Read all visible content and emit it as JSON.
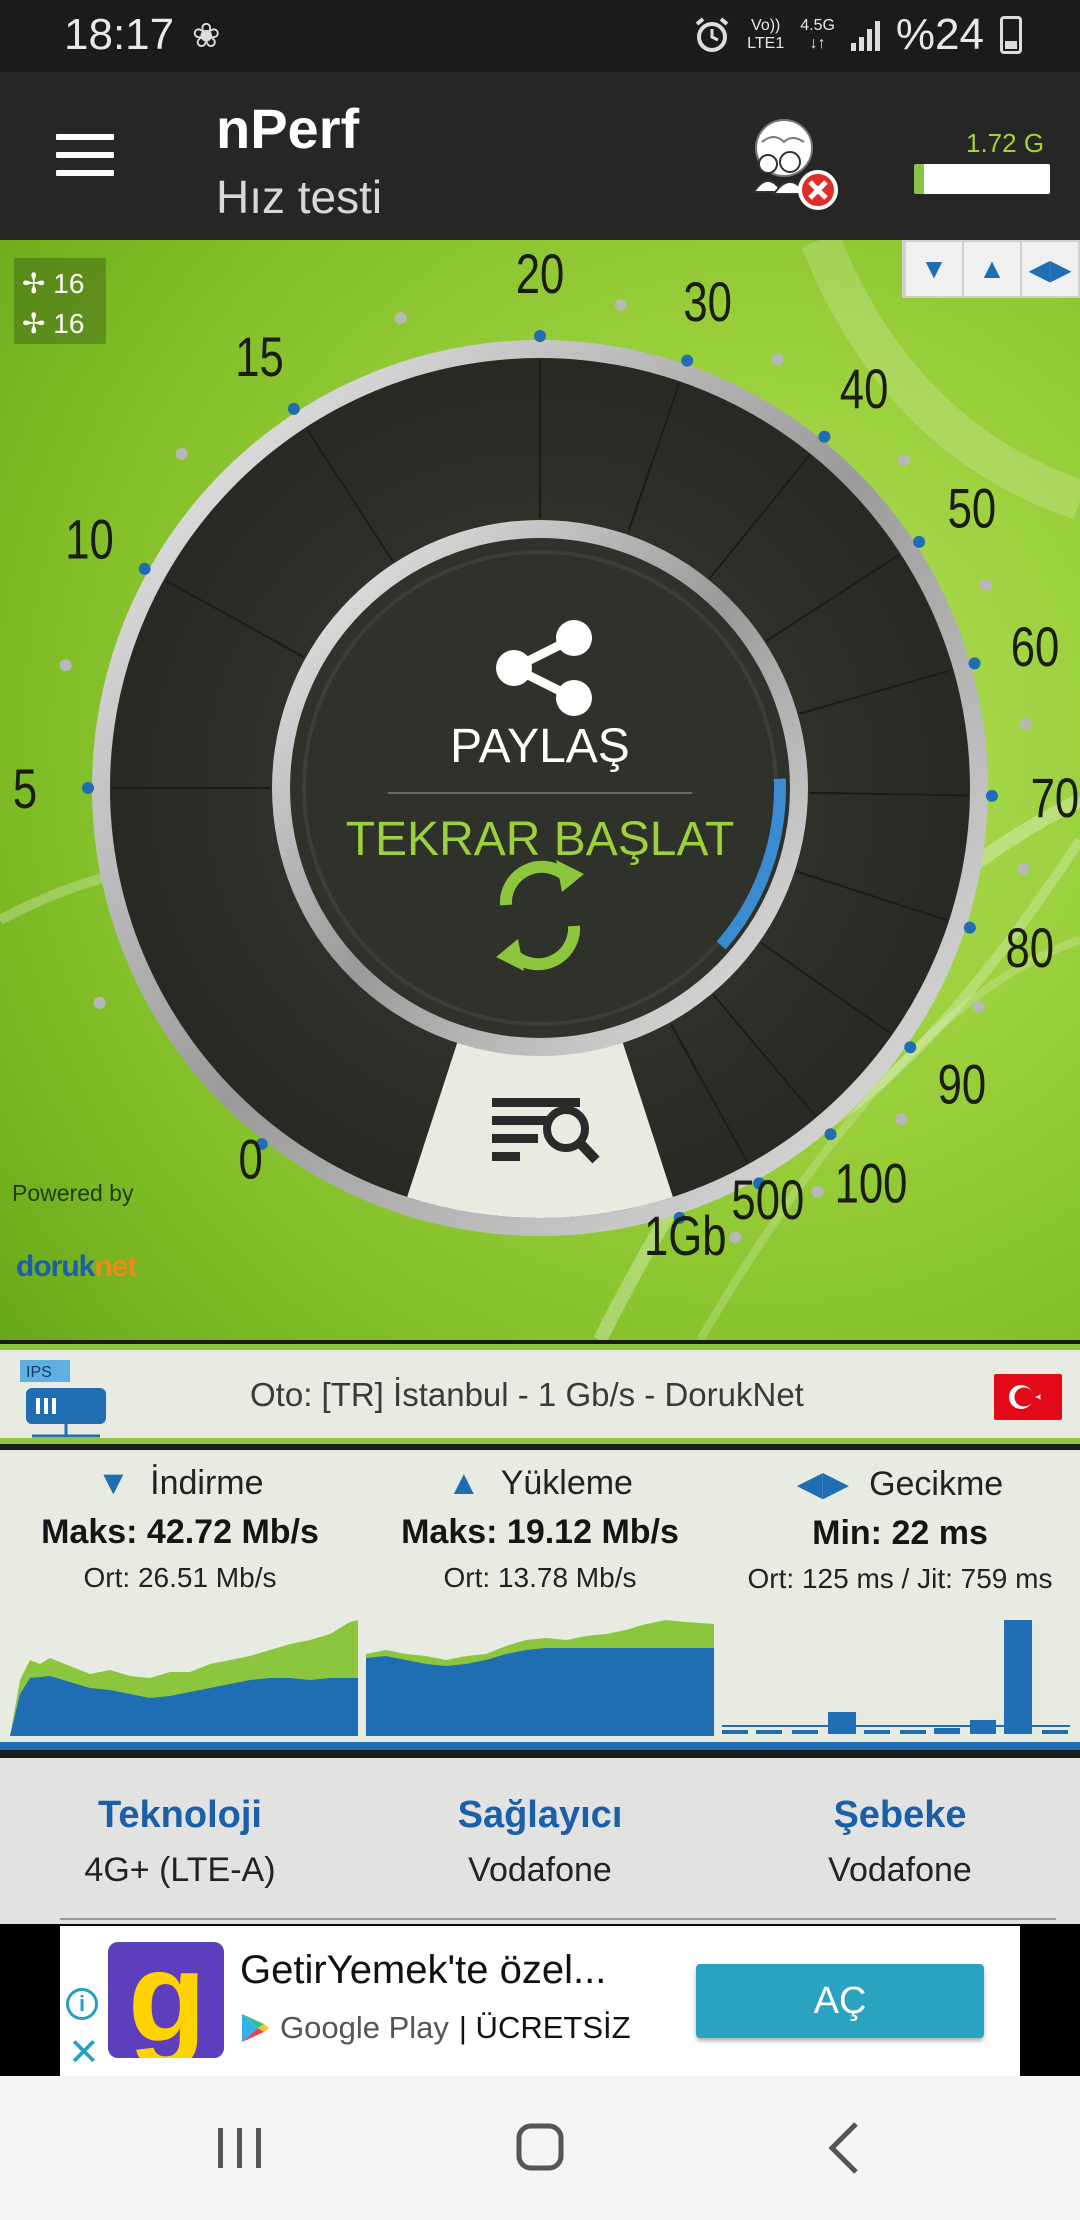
{
  "status_bar": {
    "time": "18:17",
    "volte_top": "Vo))",
    "volte_bottom": "LTE1",
    "network_top": "4.5G",
    "network_bottom": "↓↑",
    "battery": "%24"
  },
  "app_bar": {
    "title": "nPerf",
    "subtitle": "Hız testi",
    "data_used": "1.72 G"
  },
  "gauge": {
    "threads_down": "16",
    "threads_up": "16",
    "scale_labels": [
      "0",
      "5",
      "10",
      "15",
      "20",
      "30",
      "40",
      "50",
      "60",
      "70",
      "80",
      "90",
      "100",
      "500",
      "1Gb"
    ],
    "share_label": "PAYLAŞ",
    "restart_label": "TEKRAR BAŞLAT",
    "progress_fraction": 0.12,
    "powered_by": "Powered by",
    "partner_a": "doruk",
    "partner_b": "net"
  },
  "server": {
    "badge": "IPS",
    "label": "Oto: [TR] İstanbul - 1 Gb/s - DorukNet"
  },
  "stats": {
    "download": {
      "label": "İndirme",
      "max": "Maks: 42.72 Mb/s",
      "avg": "Ort: 26.51 Mb/s"
    },
    "upload": {
      "label": "Yükleme",
      "max": "Maks: 19.12 Mb/s",
      "avg": "Ort: 13.78 Mb/s"
    },
    "latency": {
      "label": "Gecikme",
      "min": "Min: 22 ms",
      "avg": "Ort: 125 ms / Jit: 759 ms"
    }
  },
  "info": {
    "technology": {
      "label": "Teknoloji",
      "value": "4G+ (LTE-A)"
    },
    "provider": {
      "label": "Sağlayıcı",
      "value": "Vodafone"
    },
    "network": {
      "label": "Şebeke",
      "value": "Vodafone"
    }
  },
  "ad": {
    "title": "GetirYemek'te özel...",
    "store": "Google Play",
    "price": "| ÜCRETSİZ",
    "button": "AÇ"
  },
  "colors": {
    "accent_green": "#8cc63f",
    "accent_blue": "#1f6db3",
    "gauge_dark": "#2f312b"
  }
}
